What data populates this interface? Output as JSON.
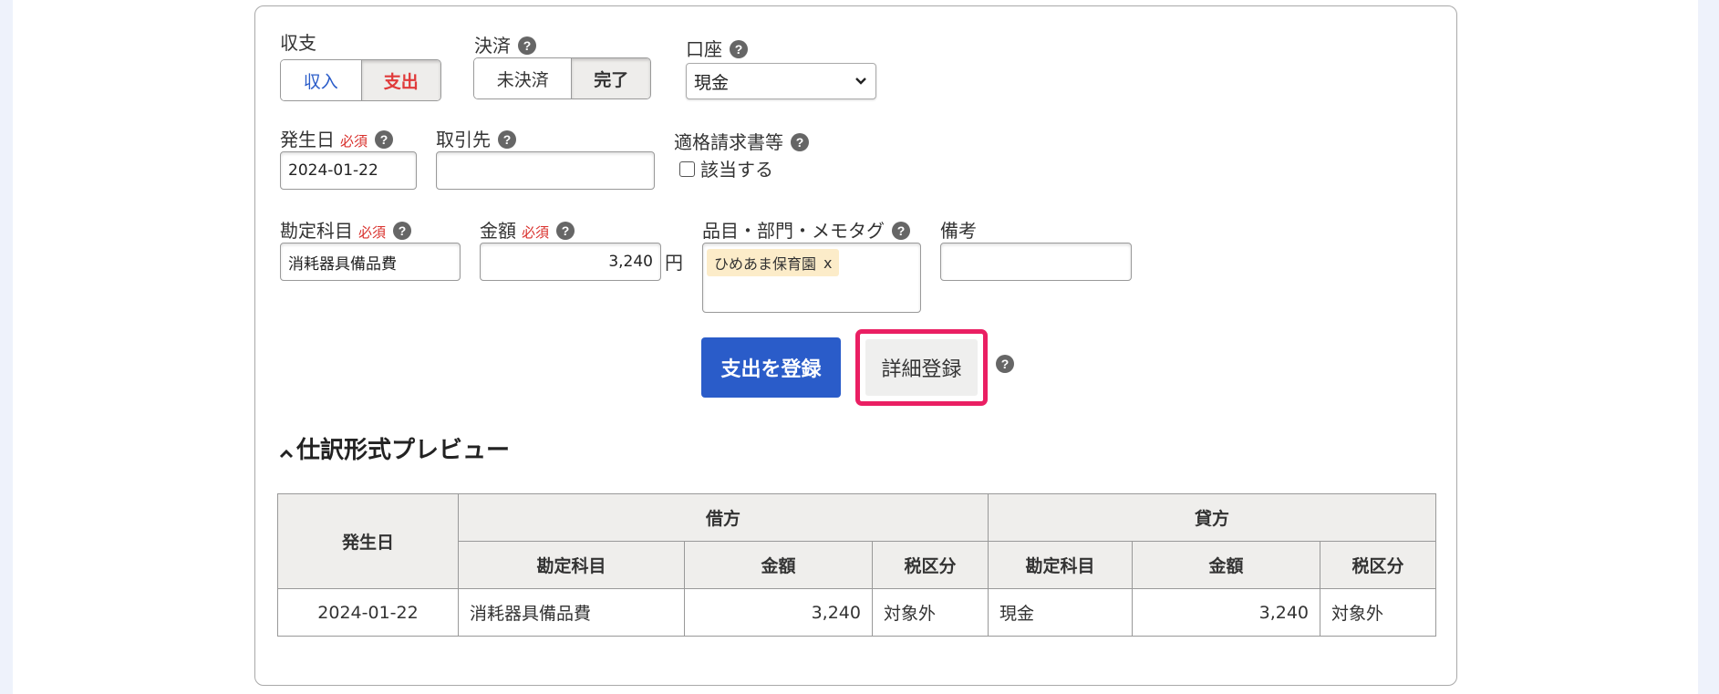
{
  "form": {
    "income_expense": {
      "label": "収支",
      "options": [
        "収入",
        "支出"
      ],
      "selected": "支出"
    },
    "settlement": {
      "label": "決済",
      "options": [
        "未決済",
        "完了"
      ],
      "selected": "完了"
    },
    "account": {
      "label": "口座",
      "value": "現金"
    },
    "date": {
      "label": "発生日",
      "required": "必須",
      "value": "2024-01-22"
    },
    "partner": {
      "label": "取引先",
      "value": ""
    },
    "invoice": {
      "label": "適格請求書等",
      "checkbox_label": "該当する",
      "checked": false
    },
    "account_item": {
      "label": "勘定科目",
      "required": "必須",
      "value": "消耗器具備品費"
    },
    "amount": {
      "label": "金額",
      "required": "必須",
      "value": "3,240",
      "unit": "円"
    },
    "tags": {
      "label": "品目・部門・メモタグ",
      "items": [
        {
          "text": "ひめあま保育園",
          "remove": "x"
        }
      ]
    },
    "memo": {
      "label": "備考",
      "value": ""
    }
  },
  "actions": {
    "register_label": "支出を登録",
    "detail_label": "詳細登録"
  },
  "help_glyph": "?",
  "preview": {
    "toggle_glyph": "^",
    "title": "仕訳形式プレビュー",
    "headers": {
      "date": "発生日",
      "debit": "借方",
      "credit": "貸方",
      "account": "勘定科目",
      "amount": "金額",
      "tax": "税区分"
    },
    "row": {
      "date": "2024-01-22",
      "debit_account": "消耗器具備品費",
      "debit_amount": "3,240",
      "debit_tax": "対象外",
      "credit_account": "現金",
      "credit_amount": "3,240",
      "credit_tax": "対象外"
    }
  },
  "colors": {
    "primary": "#2a5cc9",
    "expense_red": "#e03a3a",
    "highlight_pink": "#ea1f63",
    "tag_bg": "#fcecc9"
  }
}
